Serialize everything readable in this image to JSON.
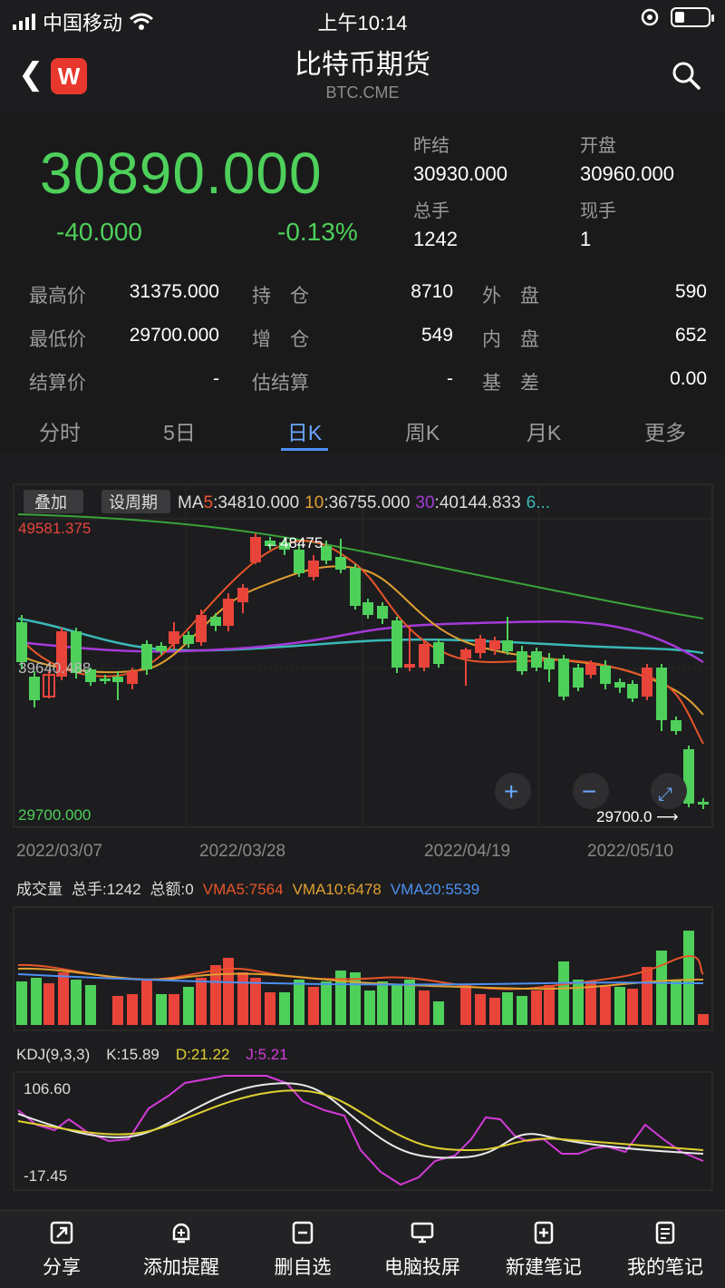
{
  "status": {
    "carrier": "中国移动",
    "time": "上午10:14"
  },
  "nav": {
    "title": "比特币期货",
    "subtitle": "BTC.CME",
    "logo_text": "W"
  },
  "quote": {
    "price": "30890.000",
    "change": "-40.000",
    "change_pct": "-0.13%",
    "prev_settle_label": "昨结",
    "prev_settle": "30930.000",
    "open_label": "开盘",
    "open": "30960.000",
    "volume_label": "总手",
    "volume": "1242",
    "cur_label": "现手",
    "cur": "1"
  },
  "stats": [
    {
      "l1": "最高价",
      "v1": "31375.000",
      "l2": "持　仓",
      "v2": "8710",
      "l3": "外　盘",
      "v3": "590"
    },
    {
      "l1": "最低价",
      "v1": "29700.000",
      "l2": "增　仓",
      "v2": "549",
      "l3": "内　盘",
      "v3": "652"
    },
    {
      "l1": "结算价",
      "v1": "-",
      "l2": "估结算",
      "v2": "-",
      "l3": "基　差",
      "v3": "0.00"
    }
  ],
  "tabs": [
    "分时",
    "5日",
    "日K",
    "周K",
    "月K",
    "更多"
  ],
  "active_tab": "日K",
  "kline": {
    "btn_overlay": "叠加",
    "btn_period": "设周期",
    "ma_prefix": "MA",
    "ma5_key": "5",
    "ma5": ":34810.000",
    "ma10_key": "10",
    "ma10": ":36755.000",
    "ma30_key": "30",
    "ma30": ":40144.833",
    "ma60_key": "6...",
    "high_label": "49581.375",
    "mid_label": "39640.488",
    "low_label": "29700.000",
    "peak_marker": "48475",
    "last_marker": "29700.0",
    "dates": [
      "2022/03/07",
      "2022/03/28",
      "2022/04/19",
      "2022/05/10"
    ]
  },
  "volume": {
    "label": "成交量",
    "total": "总手:1242",
    "amount": "总额:0",
    "vma5": "VMA5:7564",
    "vma10": "VMA10:6478",
    "vma20": "VMA20:5539"
  },
  "kdj": {
    "label": "KDJ(9,3,3)",
    "k": "K:15.89",
    "d": "D:21.22",
    "j": "J:5.21",
    "top": "106.60",
    "bottom": "-17.45"
  },
  "toolbar": [
    "分享",
    "添加提醒",
    "删自选",
    "电脑投屏",
    "新建笔记",
    "我的笔记"
  ],
  "colors": {
    "up": "#e8443a",
    "down": "#4ed05b",
    "ma5": "#e8552a",
    "ma10": "#e0a030",
    "ma30": "#a43ad8",
    "ma60": "#3ab8b8",
    "ma120": "#3aa33a"
  }
}
